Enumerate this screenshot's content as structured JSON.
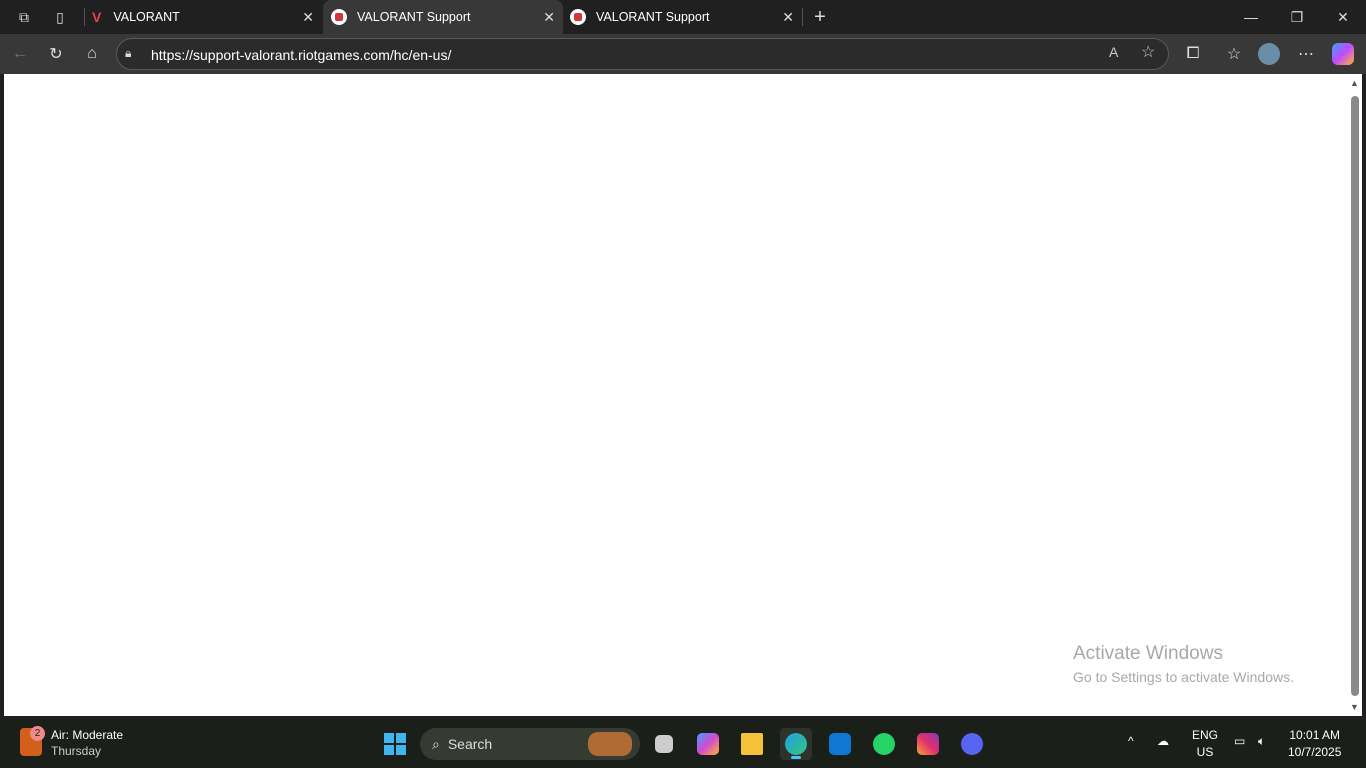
{
  "browser": {
    "tabs": [
      {
        "title": "VALORANT",
        "active": false
      },
      {
        "title": "VALORANT Support",
        "active": true
      },
      {
        "title": "VALORANT Support",
        "active": false
      }
    ],
    "address": "https://support-valorant.riotgames.com/hc/en-us/"
  },
  "watermark": {
    "title": "Activate Windows",
    "subtitle": "Go to Settings to activate Windows."
  },
  "taskbar": {
    "weather": {
      "badge": "2",
      "line1": "Air: Moderate",
      "line2": "Thursday"
    },
    "search_label": "Search",
    "language": {
      "line1": "ENG",
      "line2": "US"
    },
    "time": "10:01 AM",
    "date": "10/7/2025",
    "discord_badge": ""
  }
}
